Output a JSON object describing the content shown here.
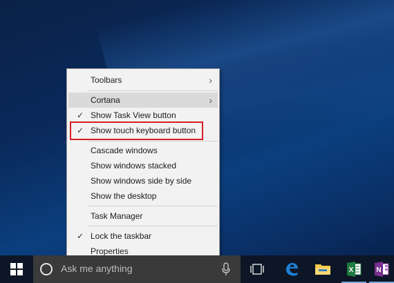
{
  "context_menu": {
    "items": [
      {
        "label": "Toolbars",
        "submenu": true,
        "checked": false
      },
      {
        "label": "Cortana",
        "submenu": true,
        "checked": false
      },
      {
        "label": "Show Task View button",
        "submenu": false,
        "checked": true
      },
      {
        "label": "Show touch keyboard button",
        "submenu": false,
        "checked": true
      },
      {
        "label": "Cascade windows",
        "submenu": false,
        "checked": false
      },
      {
        "label": "Show windows stacked",
        "submenu": false,
        "checked": false
      },
      {
        "label": "Show windows side by side",
        "submenu": false,
        "checked": false
      },
      {
        "label": "Show the desktop",
        "submenu": false,
        "checked": false
      },
      {
        "label": "Task Manager",
        "submenu": false,
        "checked": false
      },
      {
        "label": "Lock the taskbar",
        "submenu": false,
        "checked": true
      },
      {
        "label": "Properties",
        "submenu": false,
        "checked": false
      }
    ],
    "check_glyph": "✓",
    "arrow_glyph": "›"
  },
  "taskbar": {
    "search_placeholder": "Ask me anything",
    "pinned": [
      {
        "name": "task-view",
        "icon": "task-view-icon"
      },
      {
        "name": "edge",
        "icon": "edge-icon",
        "letter": "e"
      },
      {
        "name": "file-explorer",
        "icon": "folder-icon"
      },
      {
        "name": "excel",
        "icon": "excel-icon",
        "letter": "X"
      },
      {
        "name": "onenote",
        "icon": "onenote-icon",
        "letter": "N"
      }
    ]
  },
  "colors": {
    "highlight_border": "#d81e25",
    "edge_blue": "#1e7fd6",
    "excel_green": "#1f7a3e",
    "onenote_purple": "#7a2f8f",
    "folder_yellow": "#f3c84a"
  }
}
